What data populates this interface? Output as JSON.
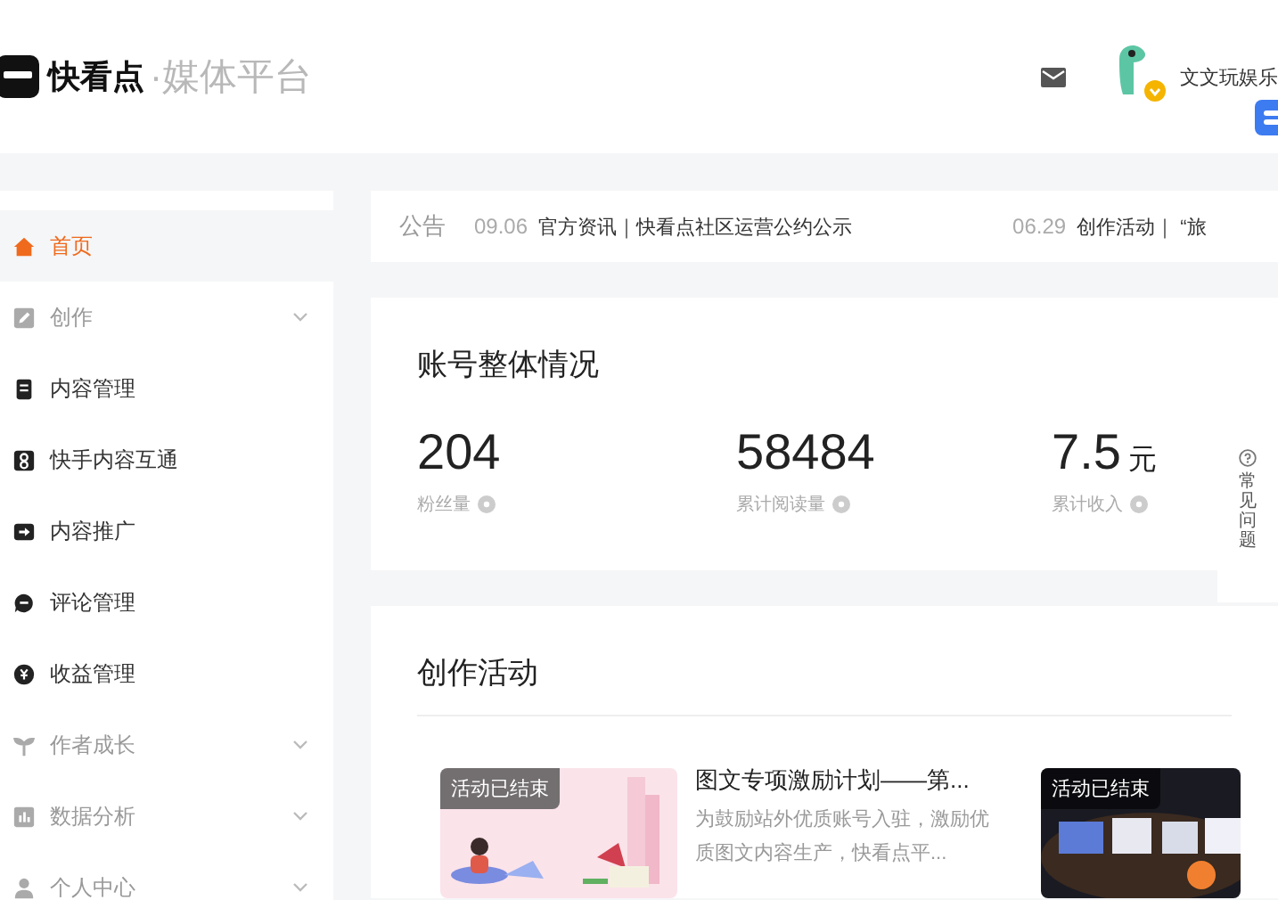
{
  "header": {
    "brand": "快看点",
    "platform": "·媒体平台",
    "user": {
      "name": "文文玩娱乐",
      "verified": true
    }
  },
  "sidebar": {
    "items": [
      {
        "label": "首页",
        "kind": "link",
        "selected": true
      },
      {
        "label": "创作",
        "kind": "group",
        "selected": false
      },
      {
        "label": "内容管理",
        "kind": "link",
        "selected": false
      },
      {
        "label": "快手内容互通",
        "kind": "link",
        "selected": false
      },
      {
        "label": "内容推广",
        "kind": "link",
        "selected": false
      },
      {
        "label": "评论管理",
        "kind": "link",
        "selected": false
      },
      {
        "label": "收益管理",
        "kind": "link",
        "selected": false
      },
      {
        "label": "作者成长",
        "kind": "group",
        "selected": false
      },
      {
        "label": "数据分析",
        "kind": "group",
        "selected": false
      },
      {
        "label": "个人中心",
        "kind": "group",
        "selected": false
      }
    ]
  },
  "notice": {
    "label": "公告",
    "items": [
      {
        "date": "09.06",
        "text": "官方资讯｜快看点社区运营公约公示"
      },
      {
        "date": "06.29",
        "text": "创作活动｜ “旅"
      }
    ]
  },
  "overview": {
    "title": "账号整体情况",
    "stats": [
      {
        "value": "204",
        "label": "粉丝量"
      },
      {
        "value": "58484",
        "label": "累计阅读量"
      },
      {
        "value": "7.5",
        "unit": "元",
        "label": "累计收入"
      }
    ]
  },
  "faq": {
    "label": "常见问题"
  },
  "activities": {
    "title": "创作活动",
    "items": [
      {
        "status": "活动已结束",
        "title": "图文专项激励计划——第...",
        "desc": "为鼓励站外优质账号入驻，激励优质图文内容生产，快看点平..."
      },
      {
        "status": "活动已结束"
      }
    ]
  }
}
